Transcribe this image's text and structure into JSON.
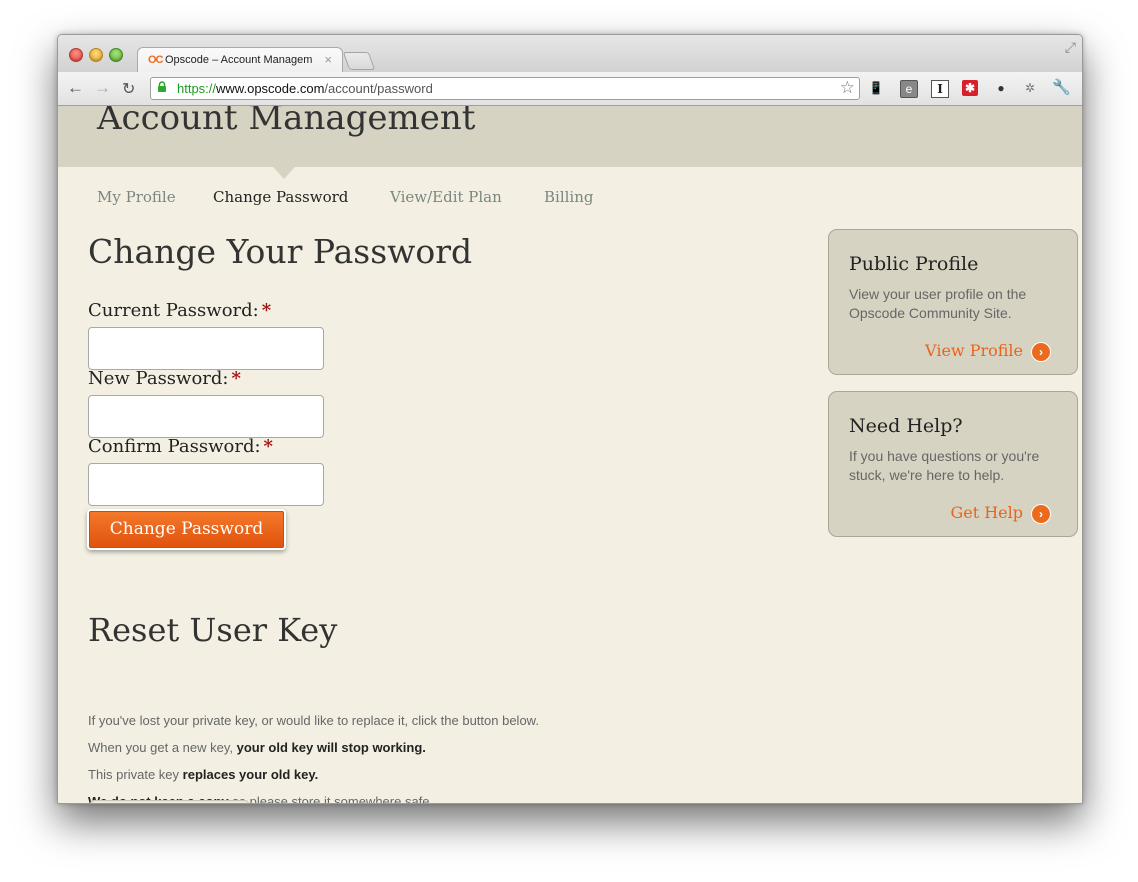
{
  "browser": {
    "tab_title": "Opscode – Account Managem",
    "tab_favicon": "OC",
    "tab_close": "×",
    "url_scheme": "https://",
    "url_host": "www.opscode.com",
    "url_path": "/account/password"
  },
  "page": {
    "heading": "Account Management",
    "subnav": [
      "My Profile",
      "Change Password",
      "View/Edit Plan",
      "Billing"
    ],
    "active_subnav": "Change Password"
  },
  "change_password": {
    "title": "Change Your Password",
    "current_label": "Current Password:",
    "new_label": "New Password:",
    "confirm_label": "Confirm Password:",
    "required_marker": "*",
    "button_label": "Change Password"
  },
  "reset_key": {
    "title": "Reset User Key",
    "line1": "If you've lost your private key, or would like to replace it, click the button below.",
    "line2_plain": "When you get a new key,",
    "line2_bold": "your old key will stop working.",
    "line3_plain": "This private key",
    "line3_bold": "replaces your old key.",
    "line4_bold": "We do not keep a copy",
    "line4_plain": "so please store it somewhere safe."
  },
  "sidebar": {
    "public_profile": {
      "title": "Public Profile",
      "text": "View your user profile on the Opscode Community Site.",
      "link": "View Profile"
    },
    "need_help": {
      "title": "Need Help?",
      "text": "If you have questions or you're stuck, we're here to help.",
      "link": "Get Help"
    }
  },
  "colors": {
    "accent": "#e8641a",
    "header_band": "#d6d3c2",
    "page_bg": "#f3f0e3"
  }
}
